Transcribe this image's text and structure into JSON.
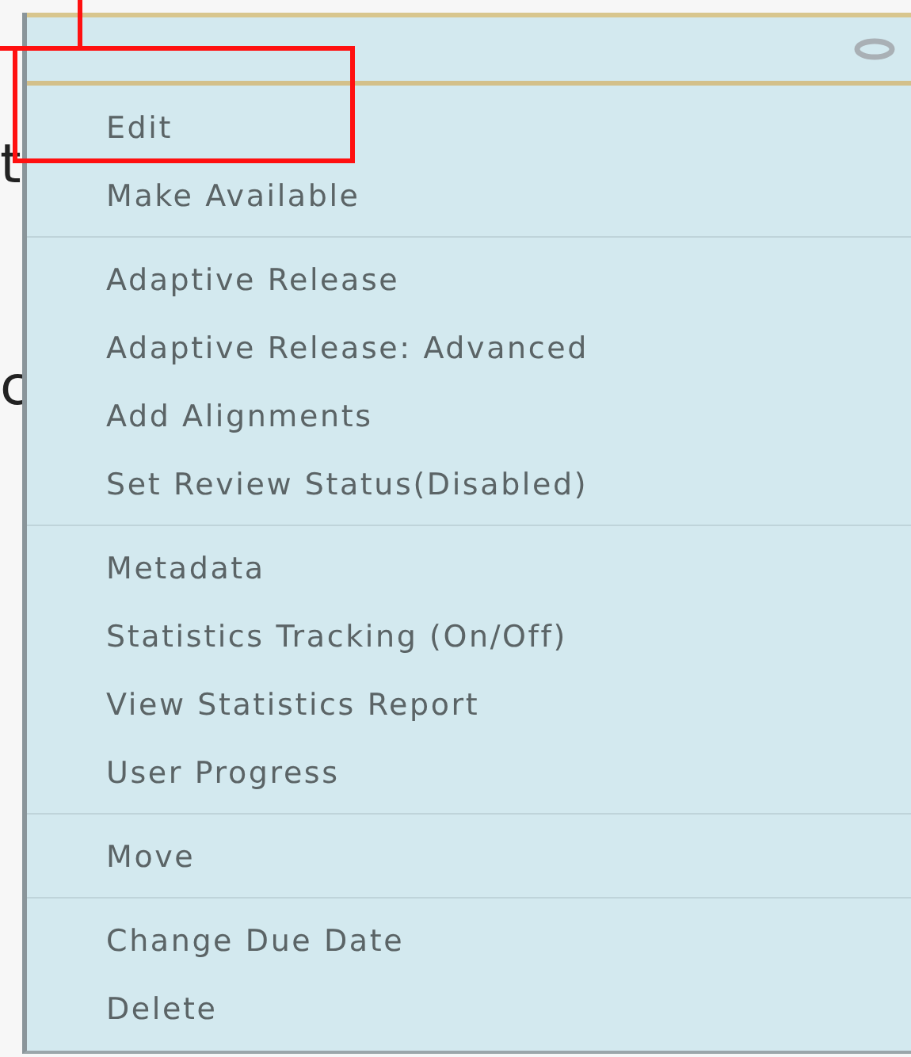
{
  "page_fragments": [
    "t",
    "c"
  ],
  "menu": {
    "groups": [
      {
        "items": [
          "Edit",
          "Make Available"
        ]
      },
      {
        "items": [
          "Adaptive Release",
          "Adaptive Release: Advanced",
          "Add Alignments",
          "Set Review Status(Disabled)"
        ]
      },
      {
        "items": [
          "Metadata",
          "Statistics Tracking (On/Off)",
          "View Statistics Report",
          "User Progress"
        ]
      },
      {
        "items": [
          "Move"
        ]
      },
      {
        "items": [
          "Change Due Date",
          "Delete"
        ]
      }
    ]
  },
  "annotations": [
    {
      "kind": "highlight-box"
    },
    {
      "kind": "highlight-box"
    }
  ]
}
